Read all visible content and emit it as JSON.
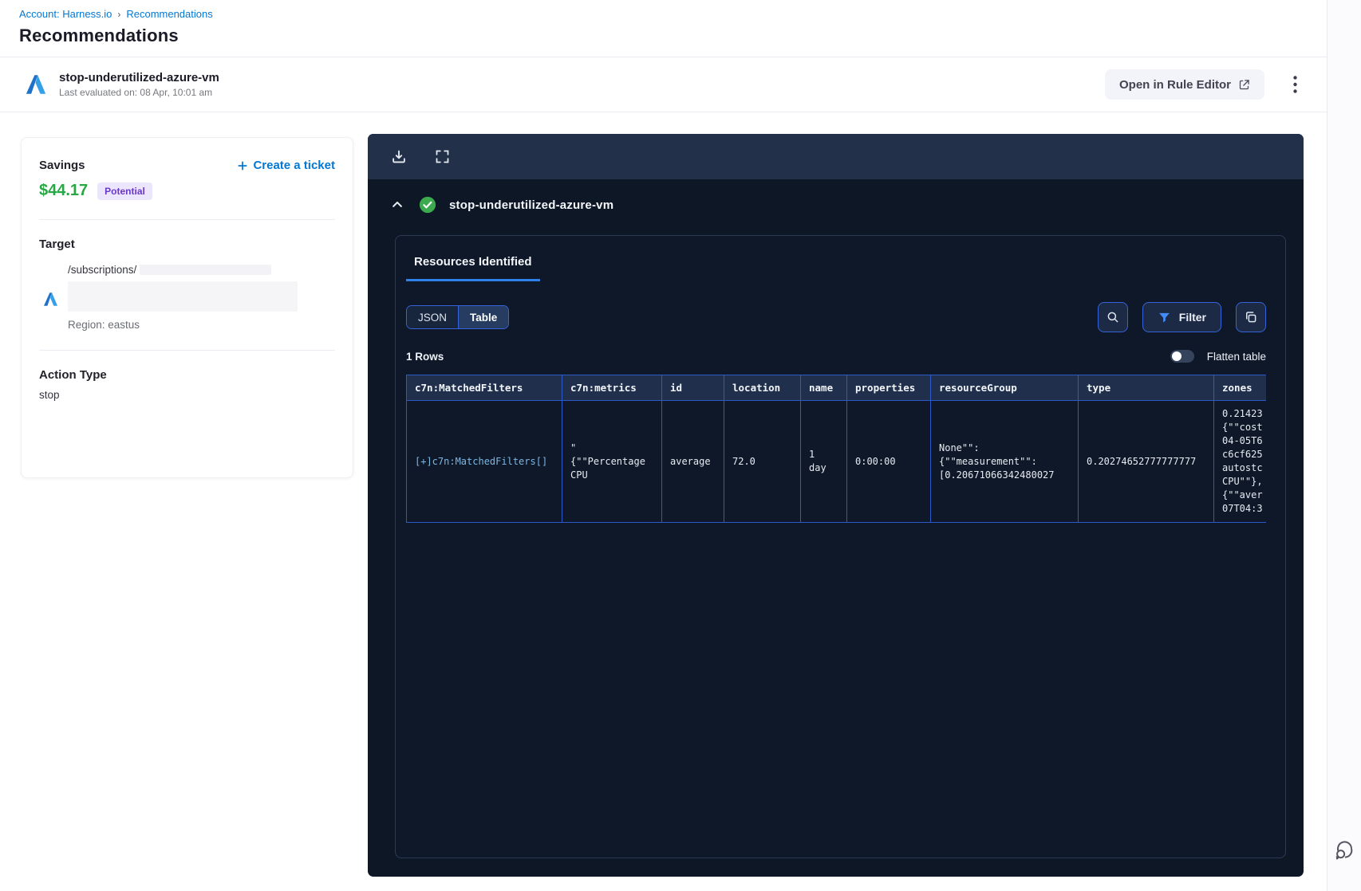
{
  "breadcrumb": {
    "account_link": "Account: Harness.io",
    "separator": "›",
    "current": "Recommendations"
  },
  "page": {
    "title": "Recommendations"
  },
  "recommendation_header": {
    "name": "stop-underutilized-azure-vm",
    "last_evaluated": "Last evaluated on: 08 Apr, 10:01 am",
    "open_rule_editor_label": "Open in Rule Editor"
  },
  "details_card": {
    "savings_label": "Savings",
    "savings_amount": "$44.17",
    "savings_badge": "Potential",
    "create_ticket_label": "Create a ticket",
    "target_label": "Target",
    "target_path": "/subscriptions/",
    "region": "Region: eastus",
    "action_type_label": "Action Type",
    "action_type_value": "stop"
  },
  "resources_panel": {
    "recommendation_name": "stop-underutilized-azure-vm",
    "tab_label": "Resources Identified",
    "view_toggle": {
      "json_label": "JSON",
      "table_label": "Table",
      "selected": "Table"
    },
    "filter_button_label": "Filter",
    "rows_count": "1 Rows",
    "flatten_toggle_label": "Flatten table",
    "table": {
      "columns": [
        "c7n:MatchedFilters",
        "c7n:metrics",
        "id",
        "location",
        "name",
        "properties",
        "resourceGroup",
        "type",
        "zones"
      ],
      "row": {
        "matched_filters": "[+]c7n:MatchedFilters[]",
        "metrics": "\"\n{\"\"Percentage\nCPU",
        "id": "average",
        "location": "72.0",
        "name": "1\nday",
        "properties": "0:00:00",
        "resource_group": "None\"\":\n{\"\"measurement\"\":\n[0.20671066342480027",
        "type": "0.20274652777777777",
        "zones": "0.21423\n{\"\"cost\n04-05T6\nc6cf625\nautostc\nCPU\"\"},\n{\"\"aver\n07T04:3"
      }
    }
  },
  "colors": {
    "accent_blue": "#0278d5",
    "savings_green": "#28a745",
    "badge_purple": "#6938c8",
    "table_border_blue": "#2e5ac9",
    "success_green": "#3cab4f",
    "panel_bg": "#0d1726"
  }
}
